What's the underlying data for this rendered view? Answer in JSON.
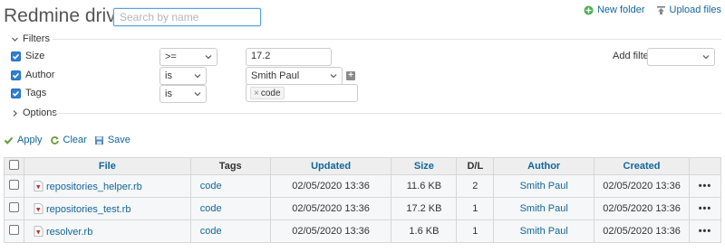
{
  "header": {
    "title": "Redmine drive",
    "search_placeholder": "Search by name",
    "new_folder": "New folder",
    "upload_files": "Upload files"
  },
  "filters": {
    "legend": "Filters",
    "rows": [
      {
        "label": "Size",
        "operator": "&gt;=",
        "operator_text": ">=",
        "value": "17.2"
      },
      {
        "label": "Author",
        "operator_text": "is",
        "value": "Smith Paul"
      },
      {
        "label": "Tags",
        "operator_text": "is",
        "chip": "code"
      }
    ],
    "add_filter_label": "Add filter",
    "add_filter_value": ""
  },
  "options": {
    "legend": "Options"
  },
  "actions": {
    "apply": "Apply",
    "clear": "Clear",
    "save": "Save"
  },
  "table": {
    "columns": [
      "File",
      "Tags",
      "Updated",
      "Size",
      "D/L",
      "Author",
      "Created"
    ],
    "rows": [
      {
        "file": "repositories_helper.rb",
        "tags": "code",
        "updated": "02/05/2020 13:36",
        "size": "11.6 KB",
        "dl": "2",
        "author": "Smith Paul",
        "created": "02/05/2020 13:36",
        "more": "•••"
      },
      {
        "file": "repositories_test.rb",
        "tags": "code",
        "updated": "02/05/2020 13:36",
        "size": "17.2 KB",
        "dl": "1",
        "author": "Smith Paul",
        "created": "02/05/2020 13:36",
        "more": "•••"
      },
      {
        "file": "resolver.rb",
        "tags": "code",
        "updated": "02/05/2020 13:36",
        "size": "1.6 KB",
        "dl": "1",
        "author": "Smith Paul",
        "created": "02/05/2020 13:36",
        "more": "•••"
      }
    ]
  },
  "colors": {
    "link": "#116699",
    "checkbox": "#2f7fd1",
    "header_bg": "#eeeeee"
  }
}
